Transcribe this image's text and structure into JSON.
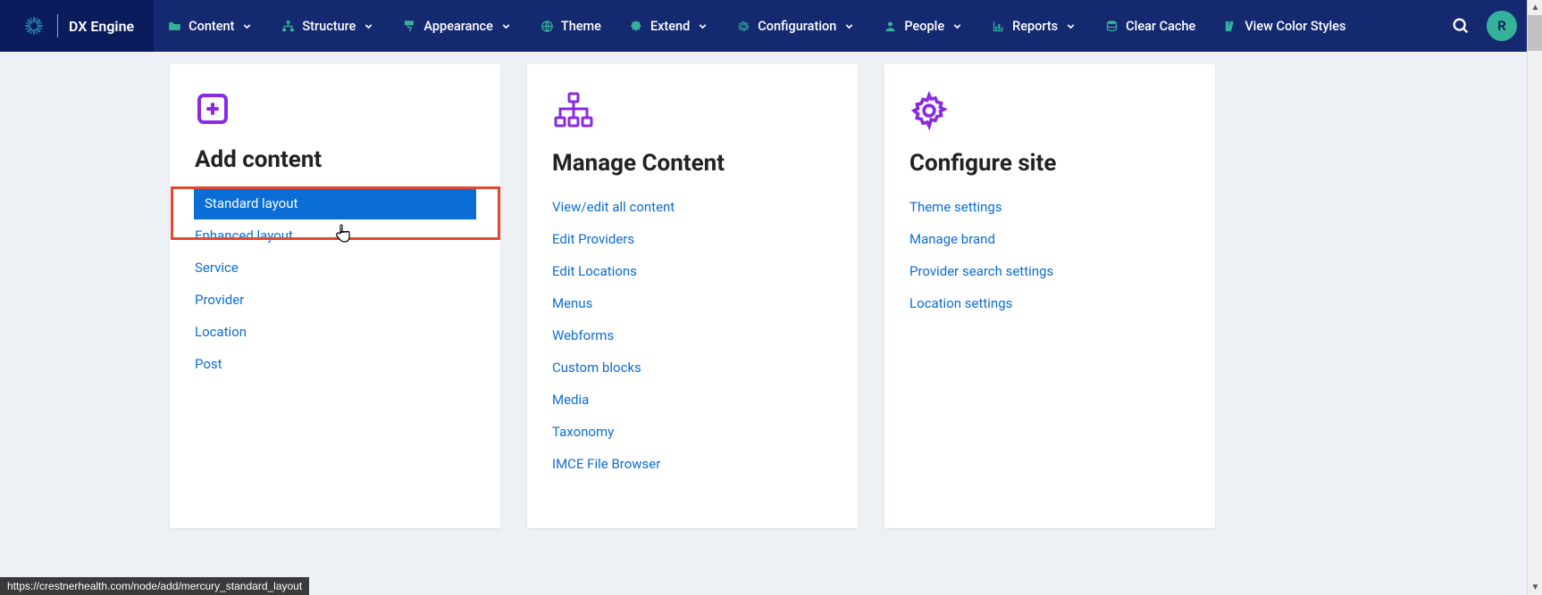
{
  "brand": {
    "name": "DX Engine"
  },
  "nav": {
    "items": [
      {
        "label": "Content",
        "has_chevron": true,
        "icon": "folder"
      },
      {
        "label": "Structure",
        "has_chevron": true,
        "icon": "sitemap"
      },
      {
        "label": "Appearance",
        "has_chevron": true,
        "icon": "paint"
      },
      {
        "label": "Theme",
        "has_chevron": false,
        "icon": "globe"
      },
      {
        "label": "Extend",
        "has_chevron": true,
        "icon": "puzzle"
      },
      {
        "label": "Configuration",
        "has_chevron": true,
        "icon": "gear"
      },
      {
        "label": "People",
        "has_chevron": true,
        "icon": "user"
      },
      {
        "label": "Reports",
        "has_chevron": true,
        "icon": "chart"
      },
      {
        "label": "Clear Cache",
        "has_chevron": false,
        "icon": "database"
      },
      {
        "label": "View Color Styles",
        "has_chevron": false,
        "icon": "swatch"
      }
    ]
  },
  "avatar": {
    "initial": "R"
  },
  "cards": [
    {
      "title": "Add content",
      "icon": "plus-box",
      "links": [
        {
          "label": "Standard layout",
          "highlighted": true
        },
        {
          "label": "Enhanced layout"
        },
        {
          "label": "Service"
        },
        {
          "label": "Provider"
        },
        {
          "label": "Location"
        },
        {
          "label": "Post"
        }
      ]
    },
    {
      "title": "Manage Content",
      "icon": "hierarchy",
      "links": [
        {
          "label": "View/edit all content"
        },
        {
          "label": "Edit Providers"
        },
        {
          "label": "Edit Locations"
        },
        {
          "label": "Menus"
        },
        {
          "label": "Webforms"
        },
        {
          "label": "Custom blocks"
        },
        {
          "label": "Media"
        },
        {
          "label": "Taxonomy"
        },
        {
          "label": "IMCE File Browser"
        }
      ]
    },
    {
      "title": "Configure site",
      "icon": "gear",
      "links": [
        {
          "label": "Theme settings"
        },
        {
          "label": "Manage brand"
        },
        {
          "label": "Provider search settings"
        },
        {
          "label": "Location settings"
        }
      ]
    }
  ],
  "status_url": "https://crestnerhealth.com/node/add/mercury_standard_layout",
  "colors": {
    "navbar": "#0b1c5c",
    "navbar_light": "#152970",
    "accent_green": "#34b39a",
    "purple": "#8a2be2",
    "link_blue": "#0b6dd6",
    "highlight_red": "#e2492f"
  }
}
